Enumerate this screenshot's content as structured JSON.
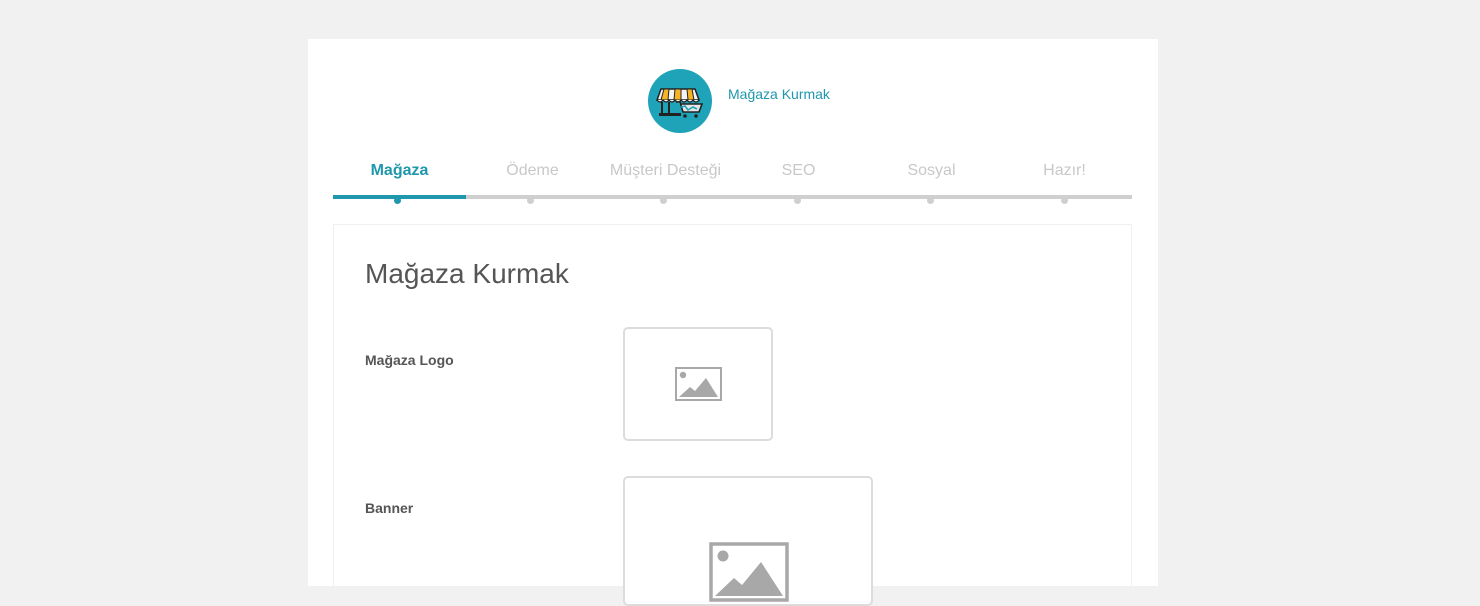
{
  "brand": {
    "title": "Mağaza Kurmak",
    "logo_icon": "store-awning-icon",
    "logo_bg": "#1ea3b8"
  },
  "steps": {
    "items": [
      {
        "label": "Mağaza",
        "active": true
      },
      {
        "label": "Ödeme",
        "active": false
      },
      {
        "label": "Müşteri Desteği",
        "active": false
      },
      {
        "label": "SEO",
        "active": false
      },
      {
        "label": "Sosyal",
        "active": false
      },
      {
        "label": "Hazır!",
        "active": false
      }
    ],
    "current_index": 0,
    "active_color": "#1f97ad",
    "inactive_color": "#c8c8c8"
  },
  "panel": {
    "title": "Mağaza Kurmak",
    "fields": {
      "logo": {
        "label": "Mağaza Logo",
        "icon": "image-placeholder-icon"
      },
      "banner": {
        "label": "Banner",
        "icon": "image-placeholder-icon"
      }
    }
  }
}
